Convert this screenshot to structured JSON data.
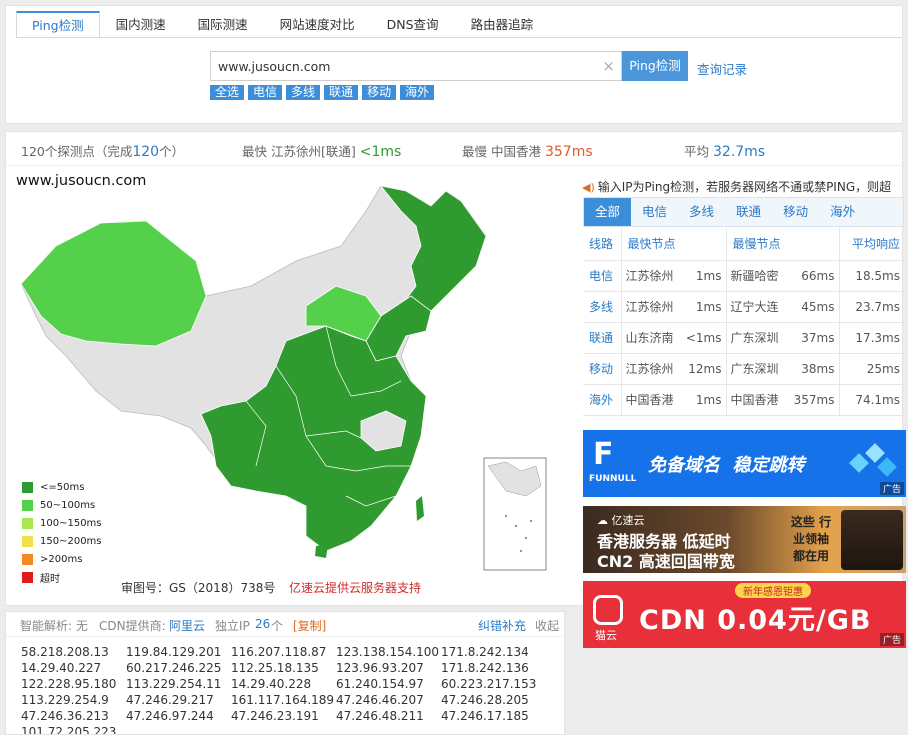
{
  "tabs": [
    "Ping检测",
    "国内测速",
    "国际测速",
    "网站速度对比",
    "DNS查询",
    "路由器追踪"
  ],
  "search": {
    "value": "www.jusoucn.com",
    "clear_icon": "close-icon",
    "button": "Ping检测",
    "history": "查询记录"
  },
  "quick_filters": [
    "全选",
    "电信",
    "多线",
    "联通",
    "移动",
    "海外"
  ],
  "summary": {
    "points_label": "120个探测点（完成",
    "points_done": "120",
    "points_suffix": "个）",
    "fastest_label": "最快 江苏徐州[联通]",
    "fastest_value": "<1ms",
    "slowest_label": "最慢 中国香港",
    "slowest_value": "357ms",
    "avg_label": "平均",
    "avg_value": "32.7ms"
  },
  "map": {
    "title": "www.jusoucn.com",
    "legend": [
      {
        "label": "<=50ms",
        "color": "#2f9a2f"
      },
      {
        "label": "50~100ms",
        "color": "#55d04a"
      },
      {
        "label": "100~150ms",
        "color": "#a9e84c"
      },
      {
        "label": "150~200ms",
        "color": "#f0e14a"
      },
      {
        "label": ">200ms",
        "color": "#f28a24"
      },
      {
        "label": "超时",
        "color": "#dd1c1c"
      }
    ],
    "review_no": "审图号：GS（2018）738号",
    "credit": "亿速云提供云服务器支持"
  },
  "notice": "输入IP为Ping检测，若服务器网络不通或禁PING，则超",
  "isp_tabs": [
    "全部",
    "电信",
    "多线",
    "联通",
    "移动",
    "海外"
  ],
  "table": {
    "headers": [
      "线路",
      "最快节点",
      "最慢节点",
      "平均响应"
    ],
    "rows": [
      {
        "isp": "电信",
        "fast_node": "江苏徐州",
        "fast_ms": "1ms",
        "slow_node": "新疆哈密",
        "slow_ms": "66ms",
        "avg": "18.5ms"
      },
      {
        "isp": "多线",
        "fast_node": "江苏徐州",
        "fast_ms": "1ms",
        "slow_node": "辽宁大连",
        "slow_ms": "45ms",
        "avg": "23.7ms"
      },
      {
        "isp": "联通",
        "fast_node": "山东济南",
        "fast_ms": "<1ms",
        "slow_node": "广东深圳",
        "slow_ms": "37ms",
        "avg": "17.3ms"
      },
      {
        "isp": "移动",
        "fast_node": "江苏徐州",
        "fast_ms": "12ms",
        "slow_node": "广东深圳",
        "slow_ms": "38ms",
        "avg": "25ms"
      },
      {
        "isp": "海外",
        "fast_node": "中国香港",
        "fast_ms": "1ms",
        "slow_node": "中国香港",
        "slow_ms": "357ms",
        "avg": "74.1ms"
      }
    ]
  },
  "ads": [
    {
      "brand": "FUNNULL",
      "text": "免备域名  稳定跳转",
      "tag": "广告"
    },
    {
      "brand": "亿速云",
      "line1": "香港服务器 低延时",
      "line2": "CN2 高速回国带宽",
      "side": "这些 行业领袖 都在用"
    },
    {
      "brand": "猫云",
      "text": "CDN 0.04元/GB",
      "badge": "新年感恩钜惠",
      "tag": "广告"
    }
  ],
  "ipbar": {
    "smart": "智能解析: 无",
    "cdn_label": "CDN提供商:",
    "cdn_value": "阿里云",
    "ip_label": "独立IP",
    "ip_count": "26",
    "ip_unit": "个",
    "copy": "[复制]",
    "report": "纠错补充",
    "collapse": "收起"
  },
  "ips": [
    "58.218.208.13",
    "119.84.129.201",
    "116.207.118.87",
    "123.138.154.100",
    "171.8.242.134",
    "14.29.40.227",
    "60.217.246.225",
    "112.25.18.135",
    "123.96.93.207",
    "171.8.242.136",
    "122.228.95.180",
    "113.229.254.11",
    "14.29.40.228",
    "61.240.154.97",
    "60.223.217.153",
    "113.229.254.9",
    "47.246.29.217",
    "161.117.164.189",
    "47.246.46.207",
    "47.246.28.205",
    "47.246.36.213",
    "47.246.97.244",
    "47.246.23.191",
    "47.246.48.211",
    "47.246.17.185",
    "101.72.205.223"
  ]
}
